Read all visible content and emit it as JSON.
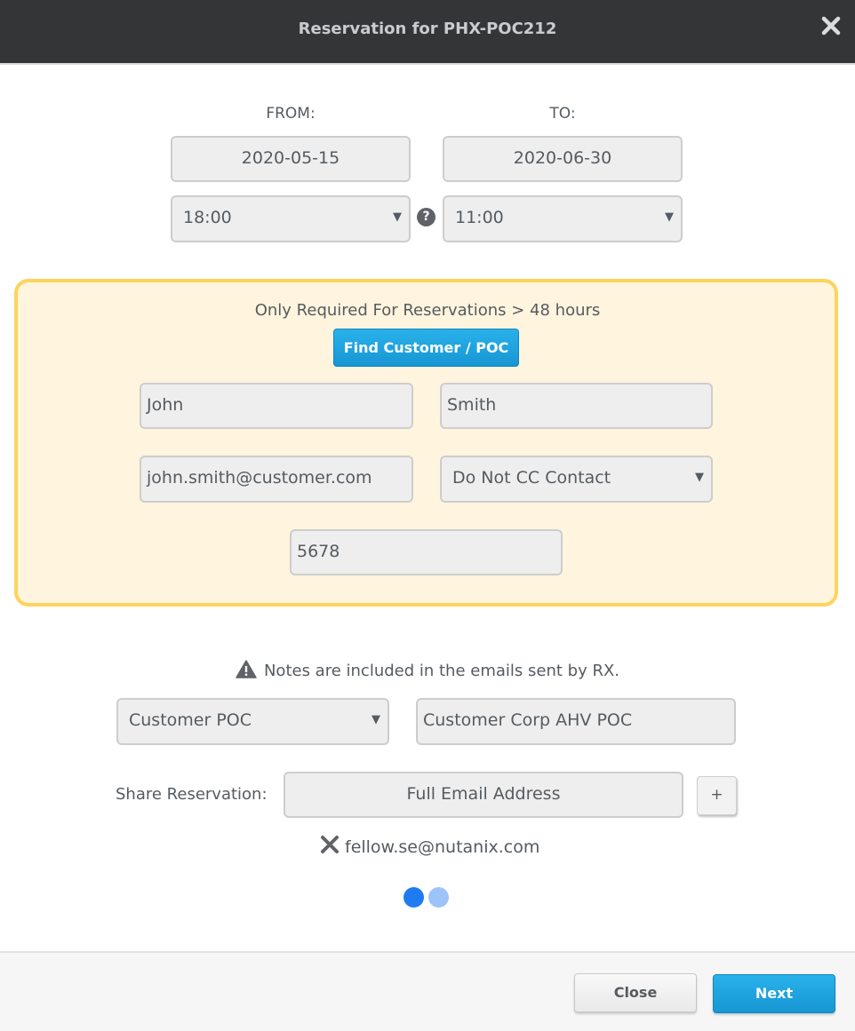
{
  "header": {
    "title": "Reservation for PHX-POC212"
  },
  "dates": {
    "from_label": "FROM:",
    "to_label": "TO:",
    "from_date": "2020-05-15",
    "to_date": "2020-06-30",
    "from_time": "18:00",
    "to_time": "11:00",
    "help_glyph": "?"
  },
  "poc": {
    "note": "Only Required For Reservations > 48 hours",
    "find_button": "Find Customer / POC",
    "first_name": "John",
    "last_name": "Smith",
    "email": "john.smith@customer.com",
    "cc_option": "Do Not CC Contact",
    "phone": "5678"
  },
  "notes": {
    "warning": "Notes are included in the emails sent by RX.",
    "type": "Customer POC",
    "text": "Customer Corp AHV POC"
  },
  "share": {
    "label": "Share Reservation:",
    "placeholder": "Full Email Address",
    "add_label": "+",
    "emails": [
      "fellow.se@nutanix.com"
    ]
  },
  "steps": {
    "total": 2,
    "current": 1
  },
  "footer": {
    "close_label": "Close",
    "next_label": "Next"
  },
  "colors": {
    "header_bg": "#333537",
    "accent_blue": "#1ea3df",
    "poc_border": "#fdd45d",
    "poc_bg": "#fff4dd",
    "step_active": "#1f7cf0",
    "step_inactive": "#9dc4f8"
  },
  "icons": {
    "close": "close-icon",
    "help": "help-icon",
    "dropdown": "chevron-down-icon",
    "warning": "warning-icon",
    "remove": "remove-icon"
  }
}
